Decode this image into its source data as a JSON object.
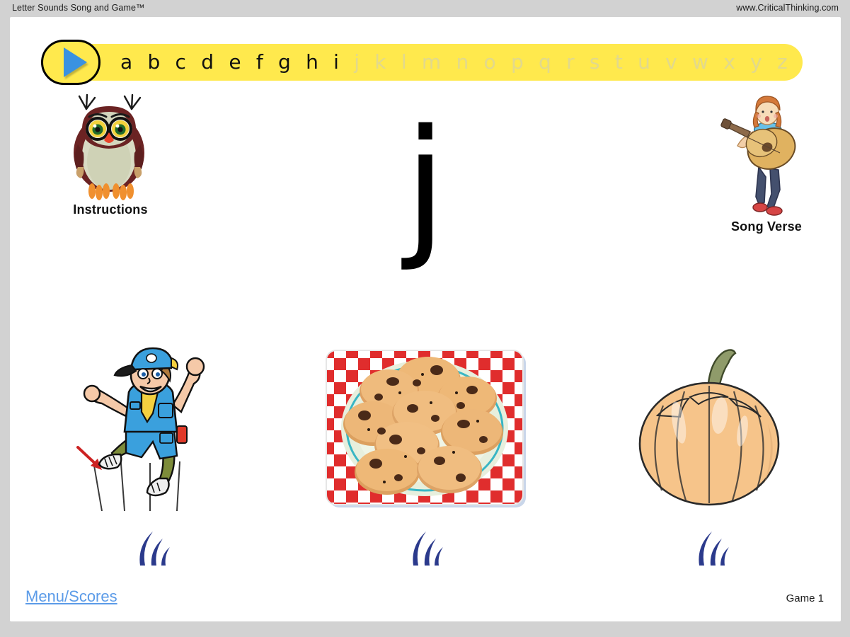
{
  "window": {
    "title": "Letter Sounds Song and Game™",
    "website": "www.CriticalThinking.com"
  },
  "alphabet_bar": {
    "play_button_label": "play-button",
    "letters": [
      {
        "char": "a",
        "state": "done"
      },
      {
        "char": "b",
        "state": "done"
      },
      {
        "char": "c",
        "state": "done"
      },
      {
        "char": "d",
        "state": "done"
      },
      {
        "char": "e",
        "state": "done"
      },
      {
        "char": "f",
        "state": "done"
      },
      {
        "char": "g",
        "state": "done"
      },
      {
        "char": "h",
        "state": "done"
      },
      {
        "char": "i",
        "state": "done"
      },
      {
        "char": "j",
        "state": "todo"
      },
      {
        "char": "k",
        "state": "todo"
      },
      {
        "char": "l",
        "state": "todo"
      },
      {
        "char": "m",
        "state": "todo"
      },
      {
        "char": "n",
        "state": "todo"
      },
      {
        "char": "o",
        "state": "todo"
      },
      {
        "char": "p",
        "state": "todo"
      },
      {
        "char": "q",
        "state": "todo"
      },
      {
        "char": "r",
        "state": "todo"
      },
      {
        "char": "s",
        "state": "todo"
      },
      {
        "char": "t",
        "state": "todo"
      },
      {
        "char": "u",
        "state": "todo"
      },
      {
        "char": "v",
        "state": "todo"
      },
      {
        "char": "w",
        "state": "todo"
      },
      {
        "char": "x",
        "state": "todo"
      },
      {
        "char": "y",
        "state": "todo"
      },
      {
        "char": "z",
        "state": "todo"
      }
    ],
    "bar_color": "#ffe94d",
    "done_color": "#111111",
    "todo_color": "#e2d98c",
    "play_triangle_color": "#3a92e0"
  },
  "instructions": {
    "label": "Instructions",
    "icon": "owl-mascot"
  },
  "song_verse": {
    "label": "Song Verse",
    "icon": "girl-with-guitar"
  },
  "main": {
    "target_letter": "j"
  },
  "choices": [
    {
      "id": "choice-jumping-boy",
      "picture": "boy-scout-jumping",
      "sound_icon": "sound-waves-icon"
    },
    {
      "id": "choice-cookies",
      "picture": "plate-of-cookies",
      "sound_icon": "sound-waves-icon"
    },
    {
      "id": "choice-pumpkin",
      "picture": "pumpkin",
      "sound_icon": "sound-waves-icon"
    }
  ],
  "footer": {
    "menu_link": "Menu/Scores",
    "game_label": "Game 1",
    "menu_link_color": "#5b9be8"
  }
}
